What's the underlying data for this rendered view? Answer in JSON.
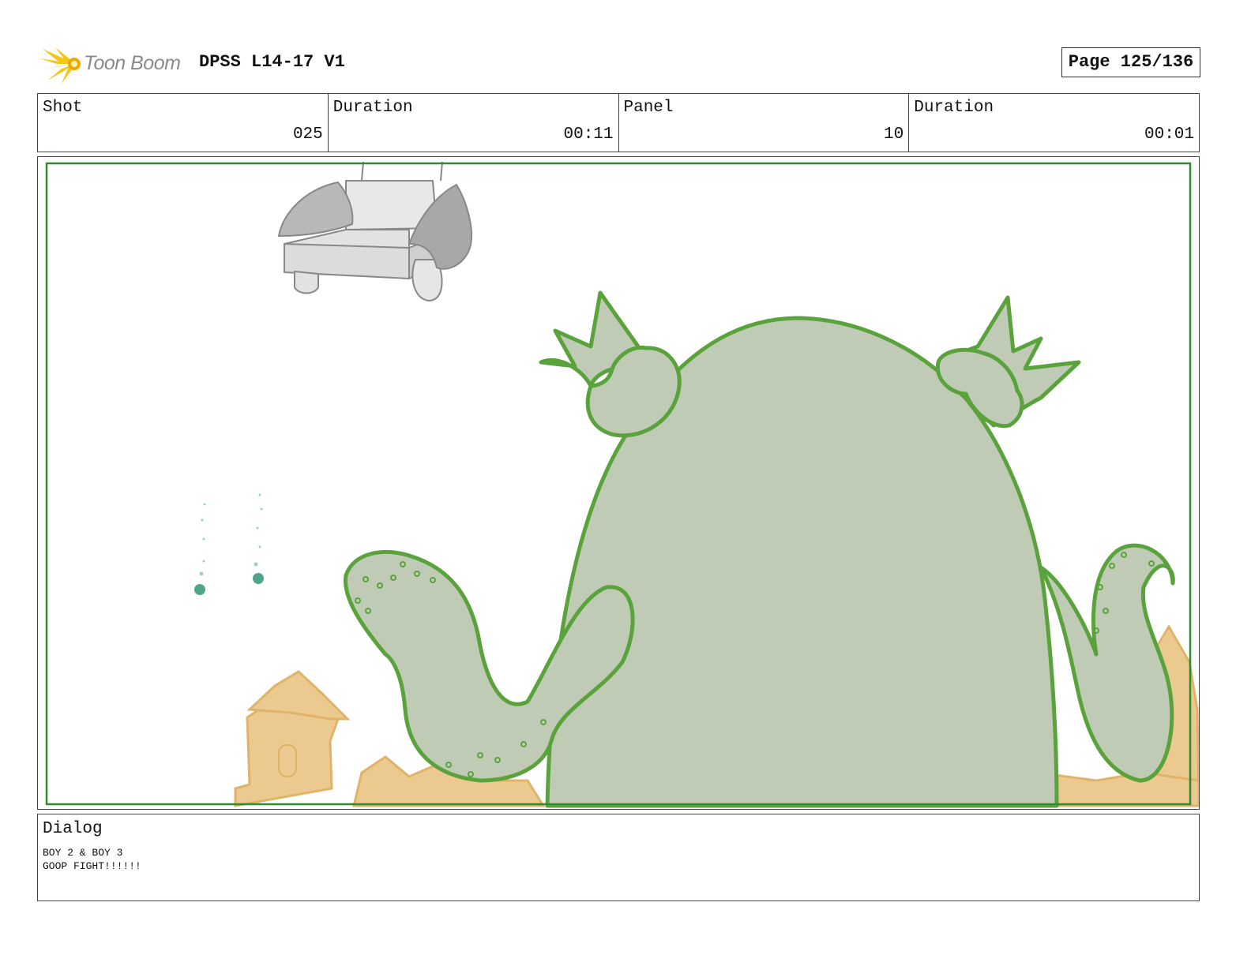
{
  "header": {
    "logo_text": "Toon Boom",
    "project_title": "DPSS L14-17 V1",
    "page_label": "Page 125/136"
  },
  "info": {
    "shot_label": "Shot",
    "shot_value": "025",
    "shot_duration_label": "Duration",
    "shot_duration_value": "00:11",
    "panel_label": "Panel",
    "panel_value": "10",
    "panel_duration_label": "Duration",
    "panel_duration_value": "00:01"
  },
  "dialog": {
    "label": "Dialog",
    "lines": [
      "BOY 2 & BOY 3",
      "GOOP FIGHT!!!!!!"
    ]
  },
  "colors": {
    "frame_green": "#2e8b2e",
    "monster_fill": "#bfcbb4",
    "monster_line": "#5aa33c",
    "sand": "#ecc98f",
    "sand_line": "#e0b36a",
    "couch": "#e2e2e2",
    "goop": "#4fa58a"
  }
}
